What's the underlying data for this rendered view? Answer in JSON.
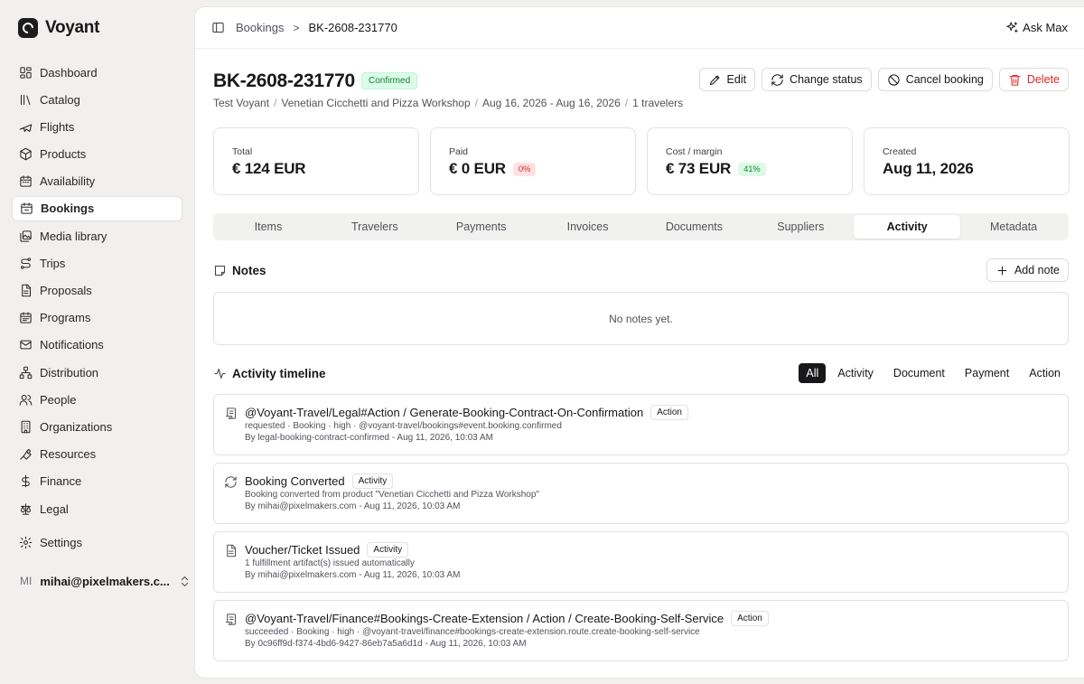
{
  "brand": {
    "name": "Voyant"
  },
  "sidebar": {
    "items": [
      {
        "label": "Dashboard",
        "icon": "dashboard-icon"
      },
      {
        "label": "Catalog",
        "icon": "library-icon"
      },
      {
        "label": "Flights",
        "icon": "plane-icon"
      },
      {
        "label": "Products",
        "icon": "package-icon"
      },
      {
        "label": "Availability",
        "icon": "calendar-icon"
      },
      {
        "label": "Bookings",
        "icon": "calendar-check-icon",
        "active": true
      },
      {
        "label": "Media library",
        "icon": "image-icon"
      },
      {
        "label": "Trips",
        "icon": "route-icon"
      },
      {
        "label": "Proposals",
        "icon": "file-text-icon"
      },
      {
        "label": "Programs",
        "icon": "calendar-range-icon"
      },
      {
        "label": "Notifications",
        "icon": "mail-icon"
      },
      {
        "label": "Distribution",
        "icon": "network-icon"
      },
      {
        "label": "People",
        "icon": "users-icon"
      },
      {
        "label": "Organizations",
        "icon": "building-icon"
      },
      {
        "label": "Resources",
        "icon": "wrench-icon"
      },
      {
        "label": "Finance",
        "icon": "dollar-icon"
      },
      {
        "label": "Legal",
        "icon": "scale-icon"
      }
    ],
    "settings": "Settings",
    "user": {
      "initials": "MI",
      "email": "mihai@pixelmakers.c..."
    }
  },
  "topbar": {
    "breadcrumb_root": "Bookings",
    "breadcrumb_current": "BK-2608-231770",
    "ask": "Ask Max"
  },
  "booking": {
    "id": "BK-2608-231770",
    "status": "Confirmed",
    "customer": "Test Voyant",
    "product": "Venetian Cicchetti and Pizza Workshop",
    "dates": "Aug 16, 2026 - Aug 16, 2026",
    "travelers": "1 travelers"
  },
  "actions": {
    "edit": "Edit",
    "change_status": "Change status",
    "cancel": "Cancel booking",
    "delete": "Delete"
  },
  "stats": [
    {
      "label": "Total",
      "value": "€ 124 EUR",
      "pill": ""
    },
    {
      "label": "Paid",
      "value": "€ 0 EUR",
      "pill": "0%",
      "pill_color": "red"
    },
    {
      "label": "Cost / margin",
      "value": "€ 73 EUR",
      "pill": "41%",
      "pill_color": "green"
    },
    {
      "label": "Created",
      "value": "Aug 11, 2026",
      "pill": ""
    }
  ],
  "tabs": [
    "Items",
    "Travelers",
    "Payments",
    "Invoices",
    "Documents",
    "Suppliers",
    "Activity",
    "Metadata"
  ],
  "active_tab": "Activity",
  "notes": {
    "title": "Notes",
    "add": "Add note",
    "empty": "No notes yet."
  },
  "timeline": {
    "title": "Activity timeline",
    "filters": [
      "All",
      "Activity",
      "Document",
      "Payment",
      "Action"
    ],
    "active_filter": "All",
    "events": [
      {
        "icon": "scroll-icon",
        "title": "@Voyant-Travel/Legal#Action / Generate-Booking-Contract-On-Confirmation",
        "tag": "Action",
        "detail": "requested · Booking · high · @voyant-travel/bookings#event.booking.confirmed",
        "meta": "By legal-booking-contract-confirmed - Aug 11, 2026, 10:03 AM"
      },
      {
        "icon": "refresh-icon",
        "title": "Booking Converted",
        "tag": "Activity",
        "detail": "Booking converted from product \"Venetian Cicchetti and Pizza Workshop\"",
        "meta": "By mihai@pixelmakers.com - Aug 11, 2026, 10:03 AM"
      },
      {
        "icon": "document-icon",
        "title": "Voucher/Ticket Issued",
        "tag": "Activity",
        "detail": "1 fulfillment artifact(s) issued automatically",
        "meta": "By mihai@pixelmakers.com - Aug 11, 2026, 10:03 AM"
      },
      {
        "icon": "scroll-icon",
        "title": "@Voyant-Travel/Finance#Bookings-Create-Extension / Action / Create-Booking-Self-Service",
        "tag": "Action",
        "detail": "succeeded · Booking · high · @voyant-travel/finance#bookings-create-extension.route.create-booking-self-service",
        "meta": "By 0c96ff9d-f374-4bd6-9427-86eb7a5a6d1d - Aug 11, 2026, 10:03 AM"
      }
    ]
  },
  "colors": {
    "accent_dark": "#18181b",
    "success": "#15803d",
    "danger": "#dc2626",
    "background": "#f1f0ee"
  }
}
